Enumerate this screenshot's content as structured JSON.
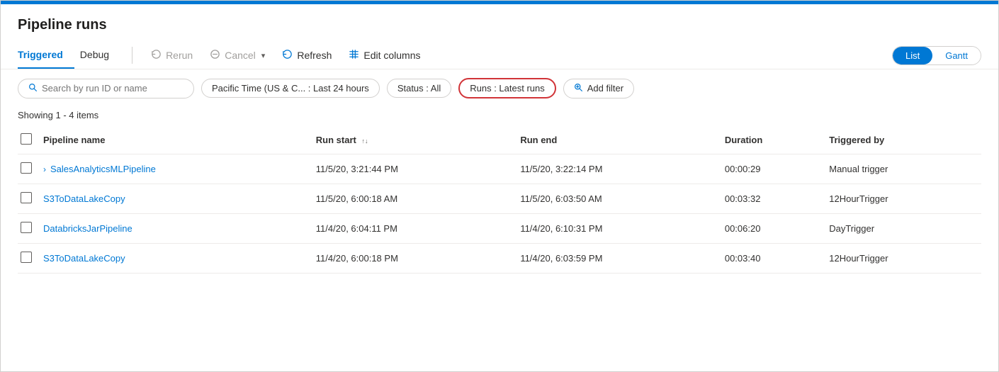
{
  "page": {
    "title": "Pipeline runs",
    "top_bar_color": "#0078d4"
  },
  "toolbar": {
    "tabs": [
      {
        "id": "triggered",
        "label": "Triggered",
        "active": true
      },
      {
        "id": "debug",
        "label": "Debug",
        "active": false
      }
    ],
    "buttons": [
      {
        "id": "rerun",
        "label": "Rerun",
        "icon": "↺",
        "disabled": true
      },
      {
        "id": "cancel",
        "label": "Cancel",
        "icon": "⊘",
        "disabled": true,
        "has_dropdown": true
      },
      {
        "id": "refresh",
        "label": "Refresh",
        "icon": "↻",
        "disabled": false
      },
      {
        "id": "edit_columns",
        "label": "Edit columns",
        "icon": "≡≡",
        "disabled": false
      }
    ],
    "view_toggle": {
      "options": [
        {
          "id": "list",
          "label": "List",
          "active": true
        },
        {
          "id": "gantt",
          "label": "Gantt",
          "active": false
        }
      ]
    }
  },
  "filters": {
    "search_placeholder": "Search by run ID or name",
    "time_filter": "Pacific Time (US & C...  :  Last 24 hours",
    "status_filter": "Status : All",
    "runs_filter": "Runs : Latest runs",
    "add_filter_label": "Add filter"
  },
  "items_count": "Showing 1 - 4 items",
  "table": {
    "columns": [
      {
        "id": "checkbox",
        "label": ""
      },
      {
        "id": "pipeline_name",
        "label": "Pipeline name"
      },
      {
        "id": "run_start",
        "label": "Run start",
        "sortable": true
      },
      {
        "id": "run_end",
        "label": "Run end"
      },
      {
        "id": "duration",
        "label": "Duration"
      },
      {
        "id": "triggered_by",
        "label": "Triggered by"
      }
    ],
    "rows": [
      {
        "id": "row1",
        "pipeline_name": "SalesAnalyticsMLPipeline",
        "expandable": true,
        "run_start": "11/5/20, 3:21:44 PM",
        "run_end": "11/5/20, 3:22:14 PM",
        "duration": "00:00:29",
        "triggered_by": "Manual trigger"
      },
      {
        "id": "row2",
        "pipeline_name": "S3ToDataLakeCopy",
        "expandable": false,
        "run_start": "11/5/20, 6:00:18 AM",
        "run_end": "11/5/20, 6:03:50 AM",
        "duration": "00:03:32",
        "triggered_by": "12HourTrigger"
      },
      {
        "id": "row3",
        "pipeline_name": "DatabricksJarPipeline",
        "expandable": false,
        "run_start": "11/4/20, 6:04:11 PM",
        "run_end": "11/4/20, 6:10:31 PM",
        "duration": "00:06:20",
        "triggered_by": "DayTrigger"
      },
      {
        "id": "row4",
        "pipeline_name": "S3ToDataLakeCopy",
        "expandable": false,
        "run_start": "11/4/20, 6:00:18 PM",
        "run_end": "11/4/20, 6:03:59 PM",
        "duration": "00:03:40",
        "triggered_by": "12HourTrigger"
      }
    ]
  }
}
